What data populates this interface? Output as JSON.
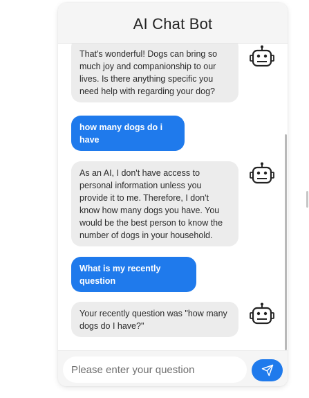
{
  "header": {
    "title": "AI Chat Bot"
  },
  "messages": [
    {
      "role": "bot",
      "text": "That's wonderful! Dogs can bring so much joy and companionship to our lives. Is there anything specific you need help with regarding your dog?",
      "avatar_icon": "robot-icon"
    },
    {
      "role": "user",
      "text": "how many dogs do i have"
    },
    {
      "role": "bot",
      "text": "As an AI, I don't have access to personal information unless you provide it to me. Therefore, I don't know how many dogs you have. You would be the best person to know the number of dogs in your household.",
      "avatar_icon": "robot-icon"
    },
    {
      "role": "user",
      "text": "What is my recently question"
    },
    {
      "role": "bot",
      "text": "Your recently question was \"how many dogs do I have?\"",
      "avatar_icon": "robot-icon"
    }
  ],
  "input": {
    "placeholder": "Please enter your question",
    "value": ""
  },
  "send_button": {
    "icon": "send-icon"
  },
  "colors": {
    "user_bubble": "#1f7aec",
    "bot_bubble": "#ececec",
    "header_bg": "#f5f5f5",
    "send_button": "#1f7aec"
  }
}
